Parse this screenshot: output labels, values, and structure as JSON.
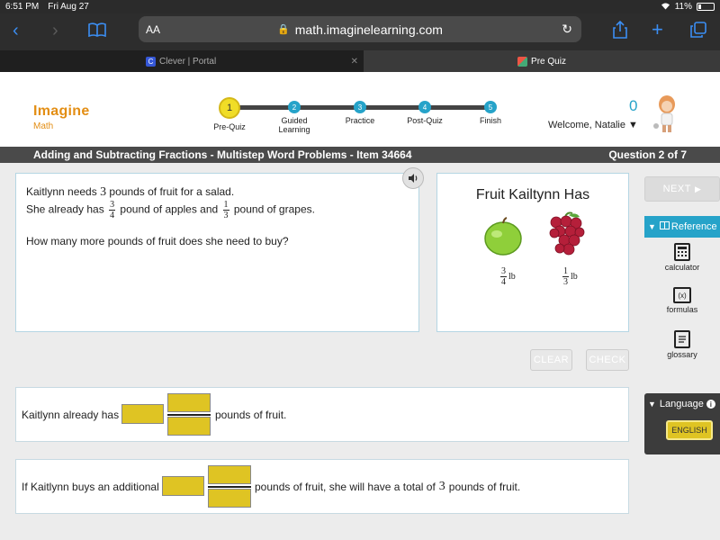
{
  "status_bar": {
    "time": "6:51 PM",
    "date": "Fri Aug 27",
    "battery": "11%"
  },
  "browser": {
    "aa_label": "AA",
    "url": "math.imaginelearning.com",
    "tabs": [
      {
        "label": "Clever | Portal",
        "favicon_letter": "C"
      },
      {
        "label": "Pre Quiz"
      }
    ]
  },
  "app": {
    "logo_top": "Imagine",
    "logo_bottom": "Math",
    "steps": [
      {
        "num": "1",
        "label": "Pre-Quiz"
      },
      {
        "num": "2",
        "label": "Guided Learning"
      },
      {
        "num": "3",
        "label": "Practice"
      },
      {
        "num": "4",
        "label": "Post-Quiz"
      },
      {
        "num": "5",
        "label": "Finish"
      }
    ],
    "score": "0",
    "welcome": "Welcome, Natalie"
  },
  "title_bar": {
    "title": "Adding and Subtracting Fractions - Multistep Word Problems - Item 34664",
    "question_count": "Question 2 of 7"
  },
  "question": {
    "line1_a": "Kaitlynn needs",
    "line1_num": "3",
    "line1_b": "pounds of fruit for a salad.",
    "line2_a": "She already has",
    "frac1_n": "3",
    "frac1_d": "4",
    "line2_b": "pound of apples and",
    "frac2_n": "1",
    "frac2_d": "3",
    "line2_c": "pound of grapes.",
    "line3": "How many more pounds of fruit does she need to buy?"
  },
  "fruit": {
    "title": "Fruit Kailtynn Has",
    "apple_n": "3",
    "apple_d": "4",
    "apple_unit": "lb",
    "grape_n": "1",
    "grape_d": "3",
    "grape_unit": "lb"
  },
  "buttons": {
    "next": "NEXT",
    "clear": "CLEAR",
    "check": "CHECK"
  },
  "answers": [
    {
      "before": "Kaitlynn already has",
      "after": "pounds of fruit."
    },
    {
      "before": "If Kaitlynn buys an additional",
      "after_a": "pounds of fruit, she will have a total of",
      "after_num": "3",
      "after_b": "pounds of fruit."
    }
  ],
  "reference": {
    "header": "Reference",
    "items": [
      "calculator",
      "formulas",
      "glossary"
    ],
    "formulas_glyph": "(x)"
  },
  "language": {
    "header": "Language",
    "info_glyph": "i",
    "button": "ENGLISH"
  },
  "colors": {
    "accent_blue": "#26a3c9",
    "answer_yellow": "#dfc423",
    "logo_orange": "#e38e14"
  }
}
